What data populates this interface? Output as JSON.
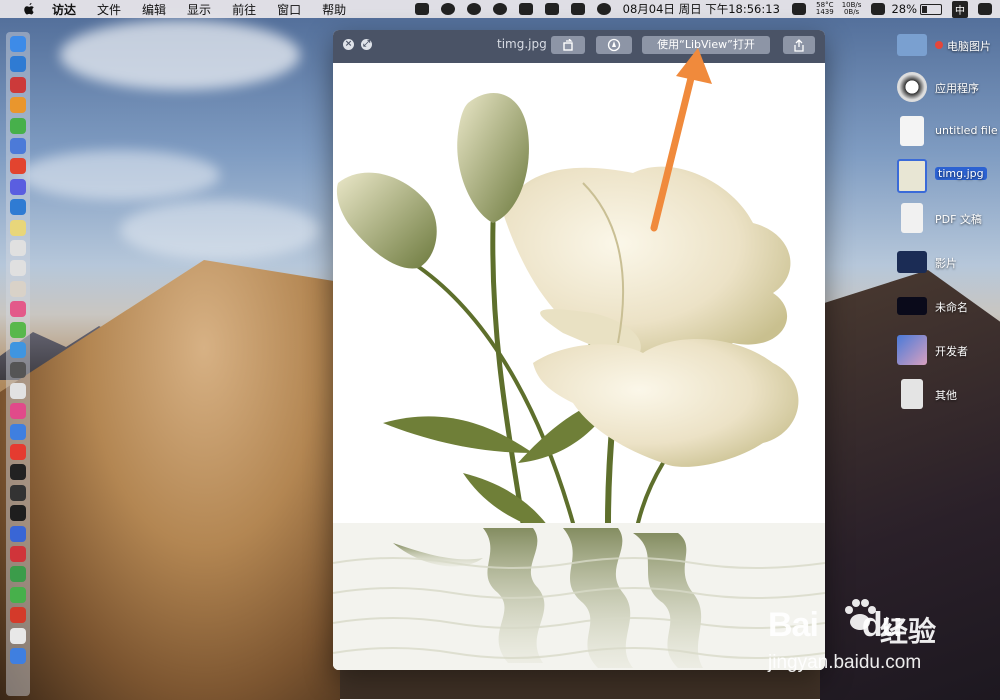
{
  "menubar": {
    "app_name": "访达",
    "items": [
      "文件",
      "编辑",
      "显示",
      "前往",
      "窗口",
      "帮助"
    ],
    "temp": "58°C",
    "fan": "1439",
    "net_up": "10B/s",
    "net_down": "0B/s",
    "clock": "08月04日 周日 下午18:56:13",
    "battery": "28%",
    "battery_level": 0.28,
    "input_method": "中"
  },
  "quicklook": {
    "filename": "timg.jpg",
    "open_with_label": "使用“LibView”打开"
  },
  "desktop_items": [
    {
      "label": "电脑图片",
      "tag": "red-tag"
    },
    {
      "label": "应用程序"
    },
    {
      "label": "untitled file"
    },
    {
      "label": "timg.jpg",
      "selected": true
    },
    {
      "label": "PDF 文稿"
    },
    {
      "label": "影片"
    },
    {
      "label": "未命名"
    },
    {
      "label": "开发者"
    },
    {
      "label": "其他"
    }
  ],
  "watermark": {
    "brand": "Bai",
    "brand_suffix": "du",
    "cn": "经验",
    "url": "jingyan.baidu.com"
  },
  "colors": {
    "arrow": "#f08a3c",
    "selection": "#2c62d2",
    "ql_bar": "#4a5366"
  }
}
